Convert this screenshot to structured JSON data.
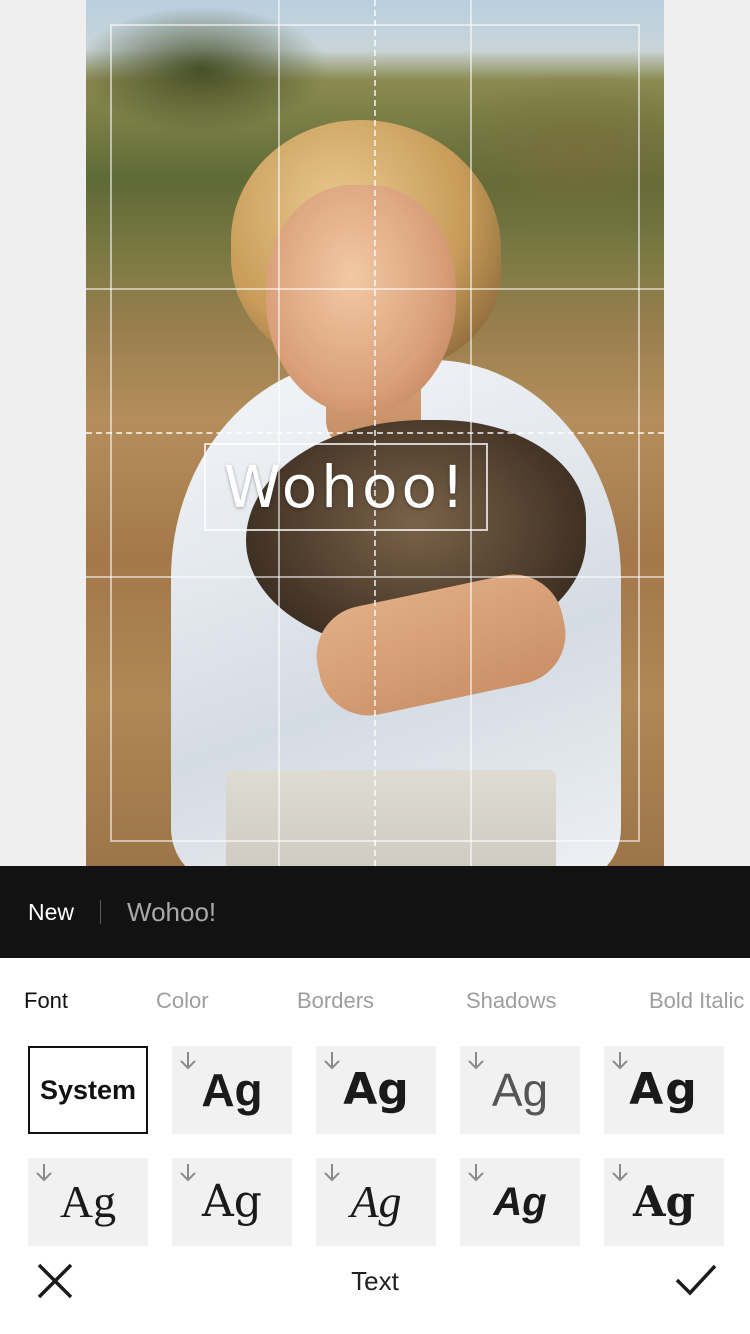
{
  "canvas": {
    "overlay_text": "Wohoo!"
  },
  "input_bar": {
    "new_label": "New",
    "input_value": "Wohoo!"
  },
  "tabs": [
    {
      "label": "Font",
      "active": true
    },
    {
      "label": "Color",
      "active": false
    },
    {
      "label": "Borders",
      "active": false
    },
    {
      "label": "Shadows",
      "active": false
    },
    {
      "label": "Bold Italic",
      "active": false
    }
  ],
  "fonts": {
    "system_label": "System",
    "sample_label": "Ag"
  },
  "bottom_bar": {
    "title": "Text"
  },
  "icons": {
    "close": "close-icon",
    "confirm": "checkmark-icon",
    "download": "download-arrow-icon"
  },
  "colors": {
    "input_bar_bg": "#121212",
    "panel_bg": "#ffffff",
    "tile_bg": "#f1f1f1",
    "active_tab": "#111111",
    "inactive_tab": "#9d9d9d"
  }
}
